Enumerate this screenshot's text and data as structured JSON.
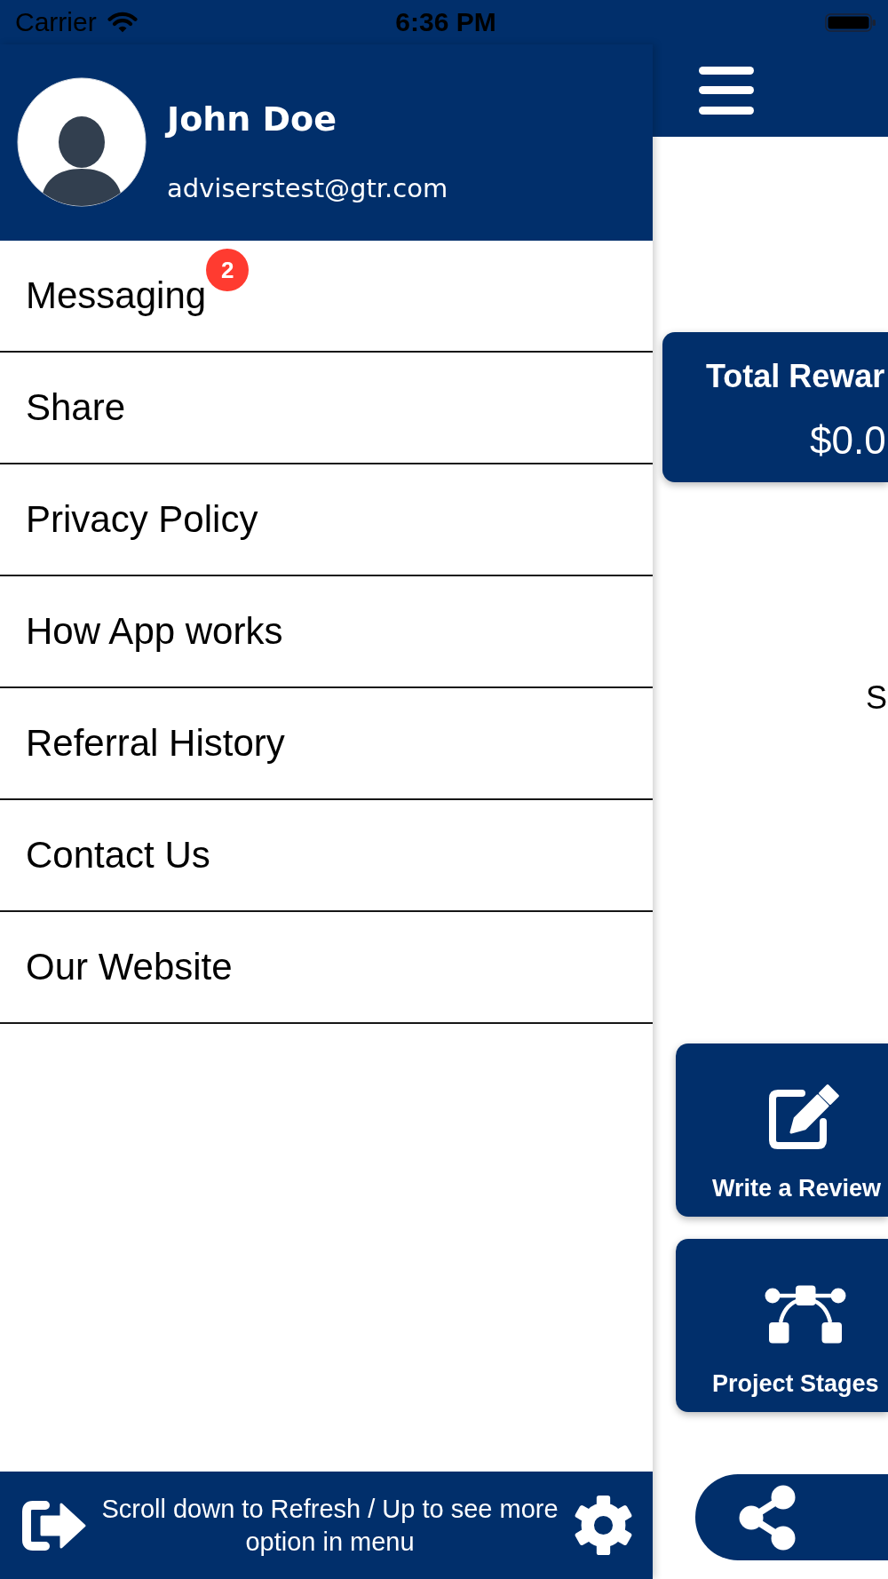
{
  "status_bar": {
    "carrier": "Carrier",
    "time": "6:36 PM"
  },
  "drawer": {
    "profile": {
      "name": "John Doe",
      "email": "adviserstest@gtr.com"
    },
    "menu": [
      {
        "label": "Messaging",
        "badge": "2"
      },
      {
        "label": "Share"
      },
      {
        "label": "Privacy Policy"
      },
      {
        "label": "How App works"
      },
      {
        "label": "Referral History"
      },
      {
        "label": "Contact Us"
      },
      {
        "label": "Our Website"
      }
    ],
    "footer": {
      "hint": "Scroll down to Refresh / Up to see more option in menu"
    }
  },
  "main": {
    "reward_card": {
      "title": "Total Rewar",
      "amount": "$0.0"
    },
    "heading": "S",
    "tiles": [
      {
        "kind": "review",
        "label": "Write a Review"
      },
      {
        "kind": "stages",
        "label": "Project Stages"
      }
    ]
  }
}
